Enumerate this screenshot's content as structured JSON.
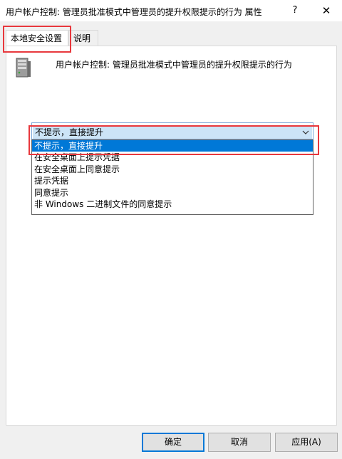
{
  "window": {
    "title": "用户帐户控制: 管理员批准模式中管理员的提升权限提示的行为 属性",
    "help_label": "?",
    "close_label": "✕"
  },
  "tabs": [
    {
      "label": "本地安全设置",
      "active": true
    },
    {
      "label": "说明",
      "active": false
    }
  ],
  "policy": {
    "icon": "server-icon",
    "name": "用户帐户控制: 管理员批准模式中管理员的提升权限提示的行为"
  },
  "combo": {
    "selected": "不提示，直接提升",
    "options": [
      "不提示，直接提升",
      "在安全桌面上提示凭据",
      "在安全桌面上同意提示",
      "提示凭据",
      "同意提示",
      "非 Windows 二进制文件的同意提示"
    ],
    "highlighted_index": 0
  },
  "buttons": {
    "ok": "确定",
    "cancel": "取消",
    "apply": "应用(A)"
  },
  "colors": {
    "highlight_annotation": "#e8383d",
    "selection": "#0078d7"
  }
}
